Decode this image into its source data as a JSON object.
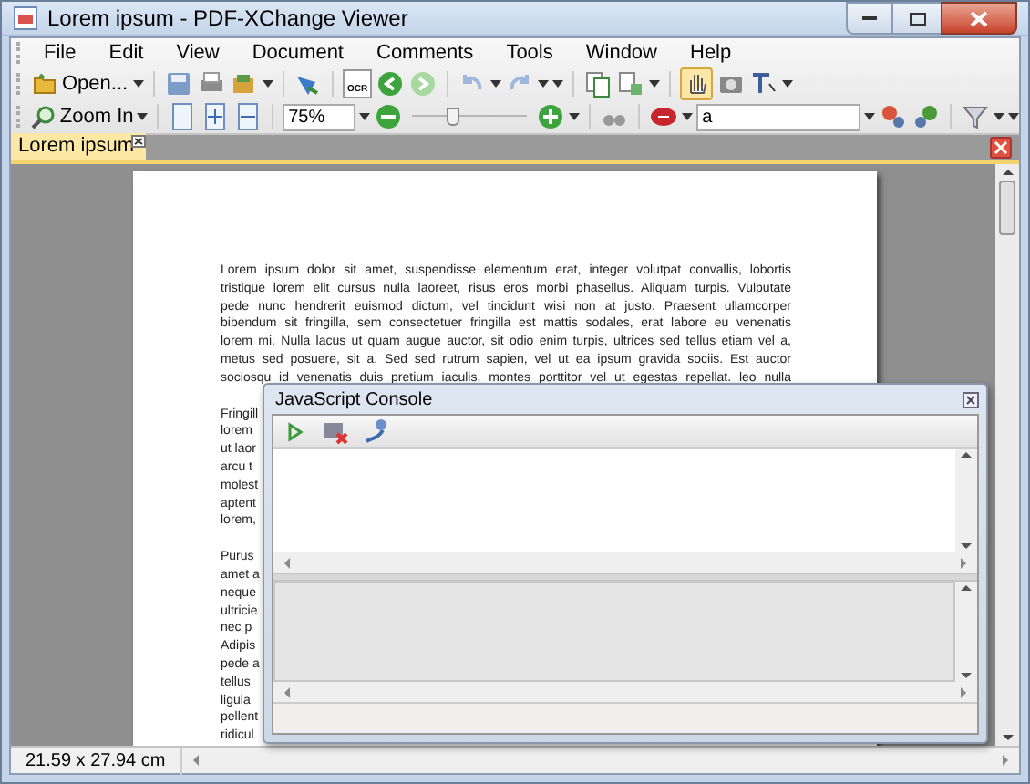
{
  "window": {
    "title": "Lorem ipsum - PDF-XChange Viewer"
  },
  "menu": [
    "File",
    "Edit",
    "View",
    "Document",
    "Comments",
    "Tools",
    "Window",
    "Help"
  ],
  "toolbar": {
    "open_label": "Open...",
    "ocr_label": "OCR",
    "zoom_label": "Zoom In",
    "zoom_value": "75%",
    "zoom_slider": {
      "level": 0.35
    },
    "search_value": "a",
    "hand_tool_selected": true
  },
  "tabs": [
    {
      "label": "Lorem ipsum",
      "selected": true
    }
  ],
  "document": {
    "paragraphs": [
      {
        "clipped": false,
        "lines": [
          "Lorem ipsum dolor sit amet, suspendisse elementum erat, integer volutpat convallis, lobortis",
          "tristique lorem elit cursus nulla laoreet, risus eros morbi phasellus. Aliquam turpis. Vulputate",
          "pede nunc hendrerit euismod dictum, vel tincidunt wisi non at justo. Praesent ullamcorper",
          "bibendum sit fringilla, sem consectetuer fringilla est mattis sodales, erat labore eu venenatis",
          "lorem mi. Nulla lacus ut quam augue auctor, sit odio enim turpis, ultrices sed tellus etiam vel a,",
          "metus sed posuere, sit a. Sed sed rutrum sapien, vel ut ea ipsum gravida sociis. Est auctor",
          "sociosqu id venenatis duis pretium iaculis, montes porttitor vel ut egestas repellat. leo nulla"
        ]
      },
      {
        "clipped": true,
        "lines": [
          "Fringill",
          "lorem",
          "ut laor",
          "arcu t",
          "molest",
          "aptent",
          "lorem,"
        ]
      },
      {
        "clipped": true,
        "lines": [
          "Purus",
          "amet a",
          "neque",
          "ultricie",
          "nec p",
          "Adipis",
          "pede a",
          "tellus",
          "ligula",
          "pellent",
          "ridicul"
        ]
      }
    ]
  },
  "console": {
    "title": "JavaScript Console"
  },
  "status_bar": {
    "page_size": "21.59 x 27.94 cm"
  }
}
